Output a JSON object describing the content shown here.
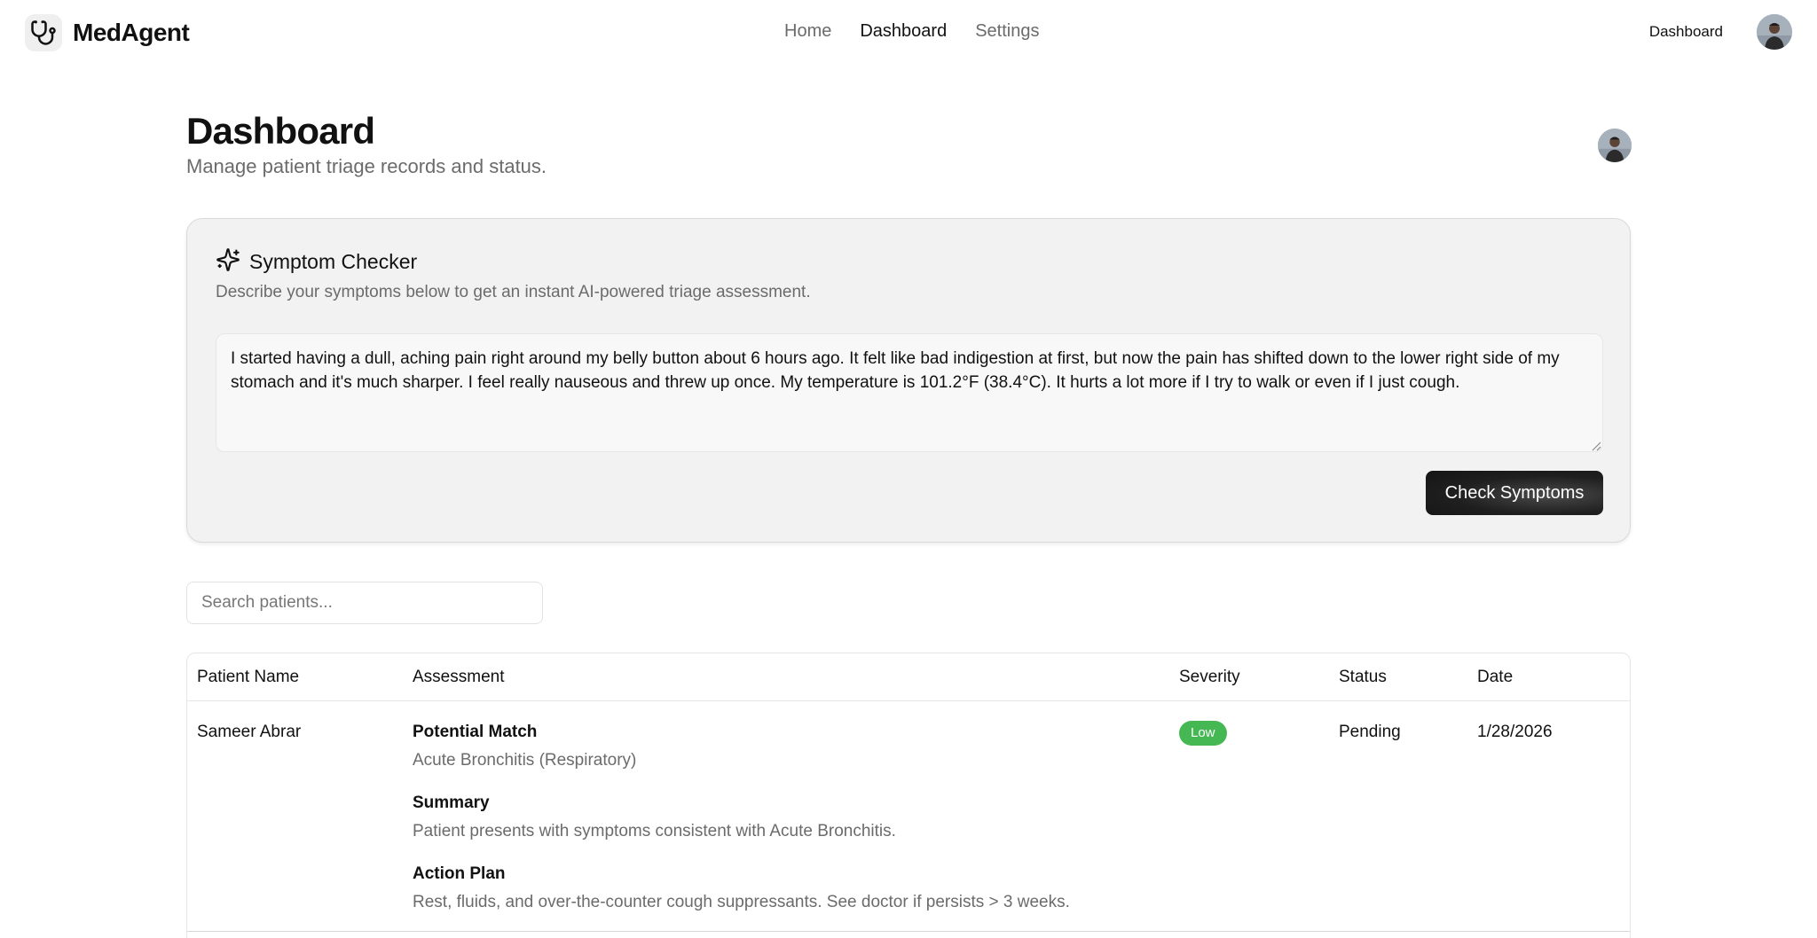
{
  "header": {
    "brand": "MedAgent",
    "nav": [
      {
        "label": "Home",
        "active": false
      },
      {
        "label": "Dashboard",
        "active": true
      },
      {
        "label": "Settings",
        "active": false
      }
    ],
    "right_link": "Dashboard"
  },
  "page": {
    "title": "Dashboard",
    "subtitle": "Manage patient triage records and status."
  },
  "symptom_checker": {
    "title": "Symptom Checker",
    "description": "Describe your symptoms below to get an instant AI-powered triage assessment.",
    "input_value": "I started having a dull, aching pain right around my belly button about 6 hours ago. It felt like bad indigestion at first, but now the pain has shifted down to the lower right side of my stomach and it's much sharper. I feel really nauseous and threw up once. My temperature is 101.2°F (38.4°C). It hurts a lot more if I try to walk or even if I just cough.",
    "button_label": "Check Symptoms"
  },
  "search": {
    "placeholder": "Search patients..."
  },
  "table": {
    "columns": [
      "Patient Name",
      "Assessment",
      "Severity",
      "Status",
      "Date"
    ],
    "rows": [
      {
        "patient_name": "Sameer Abrar",
        "potential_match_label": "Potential Match",
        "potential_match": "Acute Bronchitis (Respiratory)",
        "summary_label": "Summary",
        "summary": "Patient presents with symptoms consistent with Acute Bronchitis.",
        "action_plan_label": "Action Plan",
        "action_plan": "Rest, fluids, and over-the-counter cough suppressants. See doctor if persists > 3 weeks.",
        "severity": "Low",
        "status": "Pending",
        "date": "1/28/2026"
      }
    ]
  },
  "colors": {
    "accent_dark": "#1f1f1f",
    "severity_low": "#45b854",
    "muted_text": "#6b6b6b"
  }
}
